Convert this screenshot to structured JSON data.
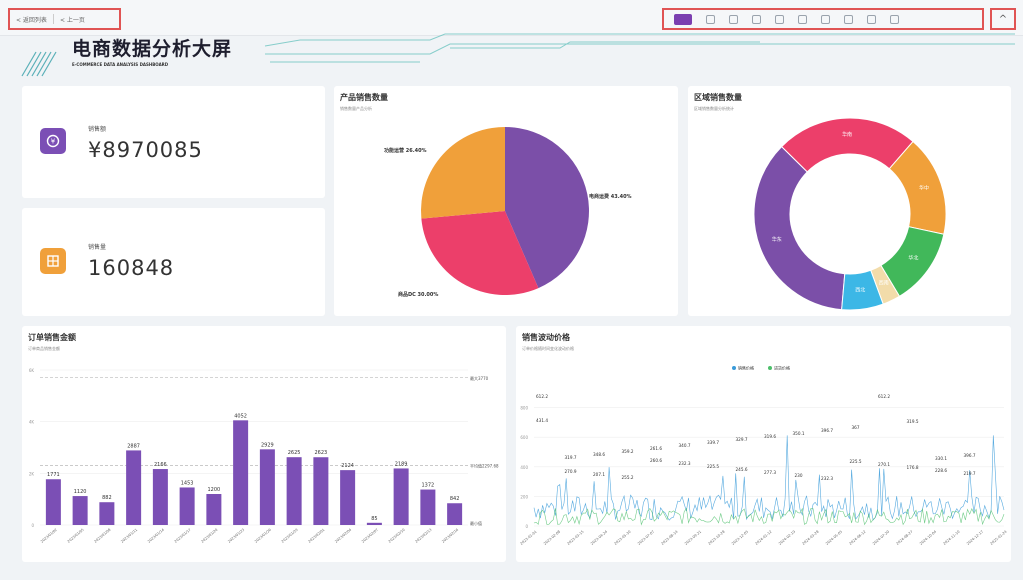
{
  "toolbar": {
    "back_label": "< 返回列表",
    "prev_label": "< 上一页",
    "tools": [
      "monitor-icon",
      "copy-icon",
      "edit-icon",
      "heart-icon",
      "share-icon",
      "export-icon",
      "grid-icon",
      "duplicate-icon",
      "refresh-icon",
      "expand-icon"
    ],
    "collapse_glyph": "^"
  },
  "header": {
    "title": "电商数据分析大屏",
    "subtitle": "E-COMMERCE DATA ANALYSIS DASHBOARD"
  },
  "kpis": [
    {
      "label": "销售额",
      "value": "¥8970085",
      "color": "#7b4fb5",
      "icon": "money-icon"
    },
    {
      "label": "销售量",
      "value": "160848",
      "color": "#f0a03a",
      "icon": "box-icon"
    }
  ],
  "pie": {
    "title": "产品销售数量",
    "subtitle": "销售数量产品分析",
    "slices": [
      {
        "label": "电商运费 43.40%",
        "value": 43.4,
        "color": "#7b4fa8"
      },
      {
        "label": "商品DC 30.00%",
        "value": 30.0,
        "color": "#ec3f6a"
      },
      {
        "label": "功能运营 26.40%",
        "value": 26.4,
        "color": "#f0a03a"
      }
    ]
  },
  "donut": {
    "title": "区域销售数量",
    "subtitle": "区域销售数量分析统计",
    "segments": [
      {
        "label": "华东",
        "value": 36,
        "color": "#7b4fa8"
      },
      {
        "label": "华南",
        "value": 24,
        "color": "#ec3f6a"
      },
      {
        "label": "华中",
        "value": 17,
        "color": "#f0a03a"
      },
      {
        "label": "华北",
        "value": 13,
        "color": "#41b85a"
      },
      {
        "label": "西南",
        "value": 3,
        "color": "#f2dcaa"
      },
      {
        "label": "西北",
        "value": 7,
        "color": "#3cb7e6"
      }
    ]
  },
  "bar": {
    "title": "订单销售金额",
    "subtitle": "订单商品销售金额",
    "max_label": "最大3770",
    "avg_label": "平均值2297.68",
    "min_label": "最小值"
  },
  "line": {
    "title": "销售波动价格",
    "subtitle": "订单价格随时间变化波动价格",
    "legend": [
      "销售价格",
      "进货价格"
    ]
  },
  "chart_data": [
    {
      "type": "pie",
      "title": "产品销售数量",
      "categories": [
        "电商运费",
        "商品DC",
        "功能运营"
      ],
      "values": [
        43.4,
        30.0,
        26.4
      ]
    },
    {
      "type": "pie",
      "title": "区域销售数量",
      "categories": [
        "华东",
        "华南",
        "华中",
        "华北",
        "西南",
        "西北"
      ],
      "values": [
        36,
        24,
        17,
        13,
        3,
        7
      ]
    },
    {
      "type": "bar",
      "title": "订单销售金额",
      "categories": [
        "2023/01/02",
        "2023/01/05",
        "2023/01/08",
        "2023/01/11",
        "2023/01/14",
        "2023/01/17",
        "2023/01/20",
        "2023/01/23",
        "2023/01/26",
        "2023/01/29",
        "2023/02/01",
        "2023/02/04",
        "2023/02/07",
        "2023/02/10",
        "2023/02/13",
        "2023/02/16"
      ],
      "values": [
        1771,
        1120,
        882,
        2887,
        2166,
        1453,
        1200,
        4052,
        2929,
        2625,
        2623,
        2124,
        85,
        2189,
        1372,
        842
      ],
      "ylim": [
        0,
        6000
      ],
      "yticks": [
        "0",
        "2K",
        "4K",
        "6K"
      ]
    },
    {
      "type": "line",
      "title": "销售波动价格",
      "series": [
        {
          "name": "销售价格",
          "color": "#3a9bd9"
        },
        {
          "name": "进货价格",
          "color": "#4cbf6a"
        }
      ],
      "ylim": [
        0,
        1000
      ],
      "yticks": [
        "0",
        "200",
        "400",
        "600",
        "800"
      ],
      "peak_labels": [
        "431.4",
        "319.7",
        "348.6",
        "359.2",
        "261.6",
        "340.7",
        "339.7",
        "329.7",
        "319.6",
        "350.1",
        "396.7",
        "367",
        "612.2",
        "319.5",
        "330.1",
        "396.7",
        "612.2",
        "270.9",
        "207.1",
        "255.2",
        "260.6",
        "232.3",
        "225.5",
        "245.6",
        "277.3",
        "230",
        "232.3",
        "225.5",
        "270.1",
        "176.8",
        "228.6",
        "219.7"
      ],
      "x_dates": [
        "2023-01-01",
        "2023-02-08",
        "2023-03-15",
        "2023-04-24",
        "2023-05-30",
        "2023-07-07",
        "2023-08-14",
        "2023-09-21",
        "2023-10-28",
        "2023-12-05",
        "2024-01-12",
        "2024-02-19",
        "2024-03-28",
        "2024-05-05",
        "2024-06-12",
        "2024-07-20",
        "2024-08-27",
        "2024-10-04",
        "2024-11-10",
        "2024-12-17",
        "2025-01-24"
      ]
    }
  ]
}
